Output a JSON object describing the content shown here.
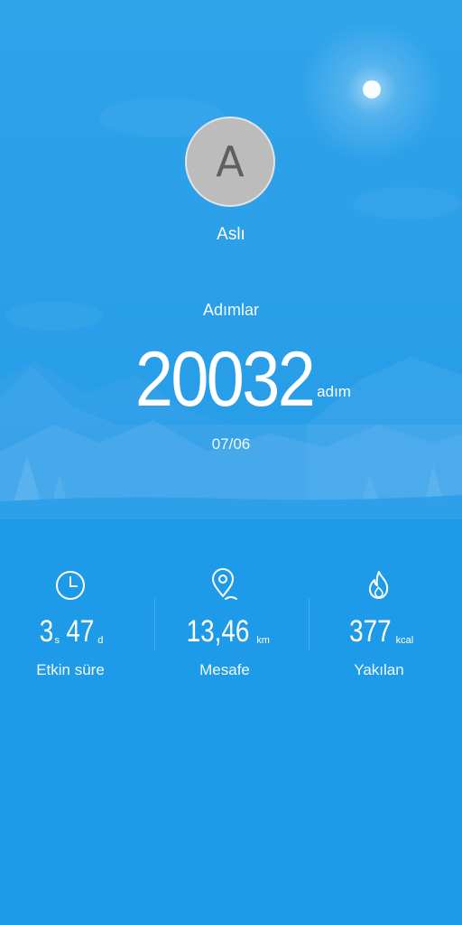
{
  "profile": {
    "avatar_letter": "A",
    "name": "Aslı"
  },
  "steps": {
    "label": "Adımlar",
    "value": "20032",
    "unit": "adım",
    "date": "07/06"
  },
  "stats": {
    "active_time": {
      "hours": "3",
      "hours_unit": "s",
      "minutes": "47",
      "minutes_unit": "d",
      "label": "Etkin süre",
      "icon": "clock-icon"
    },
    "distance": {
      "value": "13,46",
      "unit": "km",
      "label": "Mesafe",
      "icon": "location-pin-icon"
    },
    "calories": {
      "value": "377",
      "unit": "kcal",
      "label": "Yakılan",
      "icon": "flame-icon"
    }
  },
  "colors": {
    "background": "#1e9be8",
    "hero": "#2ea3ea",
    "avatar": "#bcbcbc"
  }
}
